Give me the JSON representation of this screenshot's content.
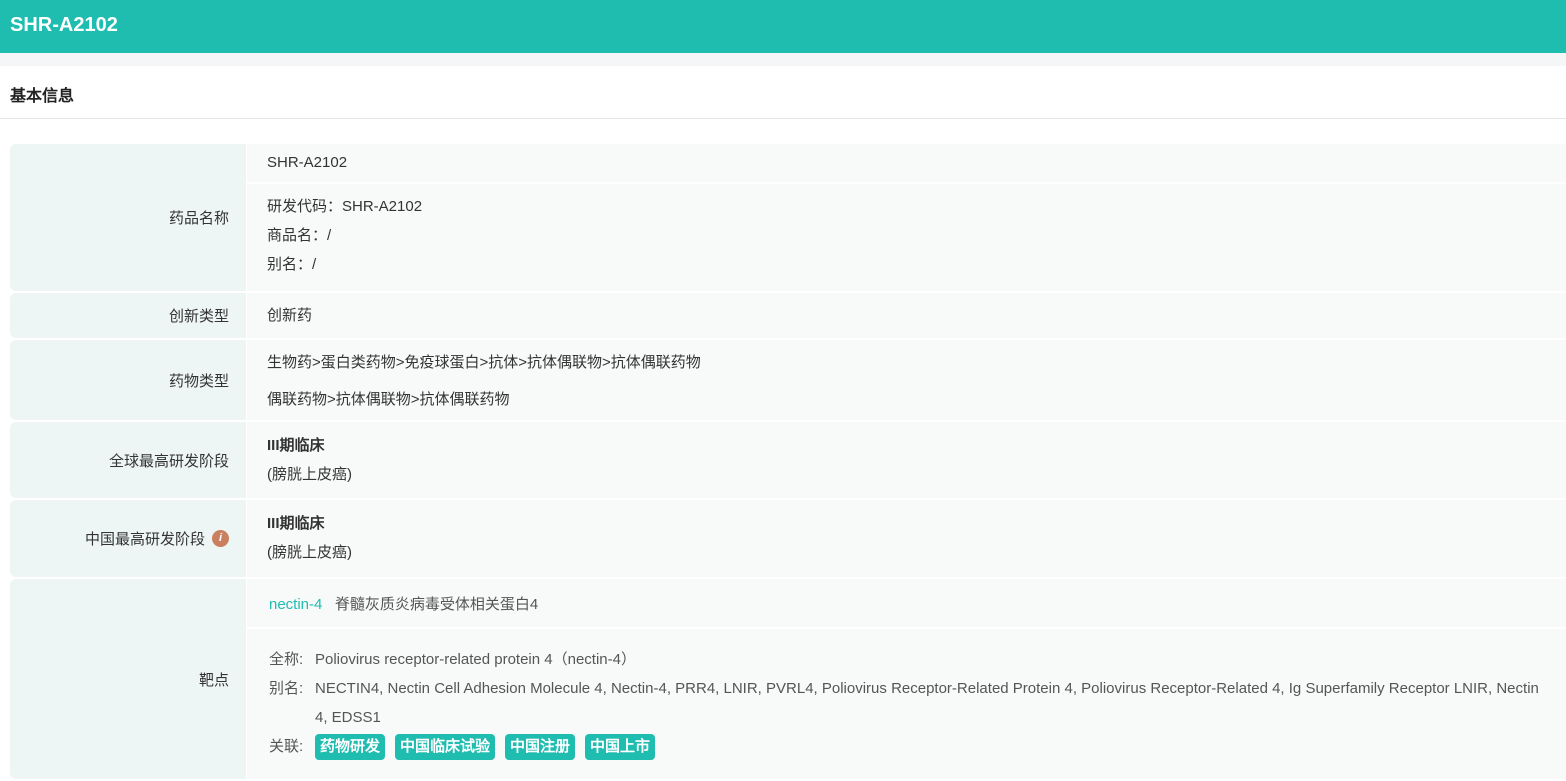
{
  "header": {
    "title": "SHR-A2102"
  },
  "section": {
    "title": "基本信息"
  },
  "rows": {
    "name": {
      "label": "药品名称",
      "primary": "SHR-A2102",
      "code": "研发代码：SHR-A2102",
      "trade": "商品名：/",
      "alias": "别名：/"
    },
    "innovation": {
      "label": "创新类型",
      "value": "创新药"
    },
    "drug_type": {
      "label": "药物类型",
      "line1": "生物药>蛋白类药物>免疫球蛋白>抗体>抗体偶联物>抗体偶联药物",
      "line2": "偶联药物>抗体偶联物>抗体偶联药物"
    },
    "global_stage": {
      "label": "全球最高研发阶段",
      "stage": "III期临床",
      "indication": "(膀胱上皮癌)"
    },
    "china_stage": {
      "label": "中国最高研发阶段",
      "info_icon": "i",
      "stage": "III期临床",
      "indication": "(膀胱上皮癌)"
    },
    "target": {
      "label": "靶点",
      "symbol": "nectin-4",
      "name_cn": "脊髓灰质炎病毒受体相关蛋白4",
      "fullname_key": "全称:",
      "fullname": "Poliovirus receptor-related protein 4（nectin-4）",
      "alias_key": "别名:",
      "alias": "NECTIN4, Nectin Cell Adhesion Molecule 4, Nectin-4, PRR4, LNIR, PVRL4, Poliovirus Receptor-Related Protein 4, Poliovirus Receptor-Related 4, Ig Superfamily Receptor LNIR, Nectin 4, EDSS1",
      "related_key": "关联:",
      "tags": [
        "药物研发",
        "中国临床试验",
        "中国注册",
        "中国上市"
      ]
    }
  }
}
